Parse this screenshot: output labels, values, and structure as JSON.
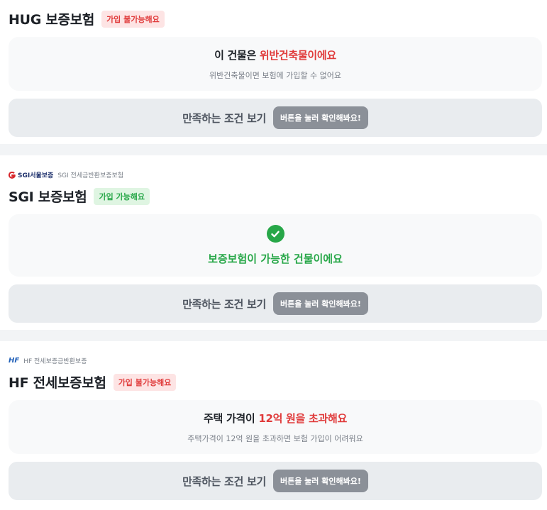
{
  "sections": [
    {
      "title": "HUG 보증보험",
      "badge": "가입 불가능해요",
      "card": {
        "headline_prefix": "이 건물은 ",
        "headline_highlight": "위반건축물이에요",
        "sub": "위반건축물이면 보험에 가입할 수 없어요"
      },
      "button": {
        "label": "만족하는 조건 보기",
        "pill": "버튼을 눌러 확인해봐요!"
      }
    },
    {
      "provider_logo": "SGI서울보증",
      "provider_sub": "SGI 전세금반환보증보험",
      "title": "SGI 보증보험",
      "badge": "가입 가능해요",
      "card": {
        "ok_text": "보증보험이 가능한 건물이에요"
      },
      "button": {
        "label": "만족하는 조건 보기",
        "pill": "버튼을 눌러 확인해봐요!"
      }
    },
    {
      "provider_logo": "HF",
      "provider_sub": "HF 전세보증금반환보증",
      "title": "HF 전세보증보험",
      "badge": "가입 불가능해요",
      "card": {
        "headline_prefix": "주택 가격이 ",
        "headline_highlight": "12억 원을 초과해요",
        "sub": "주택가격이 12억 원을 초과하면 보험 가입이 어려워요"
      },
      "button": {
        "label": "만족하는 조건 보기",
        "pill": "버튼을 눌러 확인해봐요!"
      }
    }
  ],
  "colors": {
    "danger": "#e03b3b",
    "success": "#27a748",
    "pill": "#8b9098"
  },
  "icons": {
    "success": "check-circle-icon",
    "sgi": "sgi-logo-icon",
    "hf": "hf-logo-icon"
  }
}
